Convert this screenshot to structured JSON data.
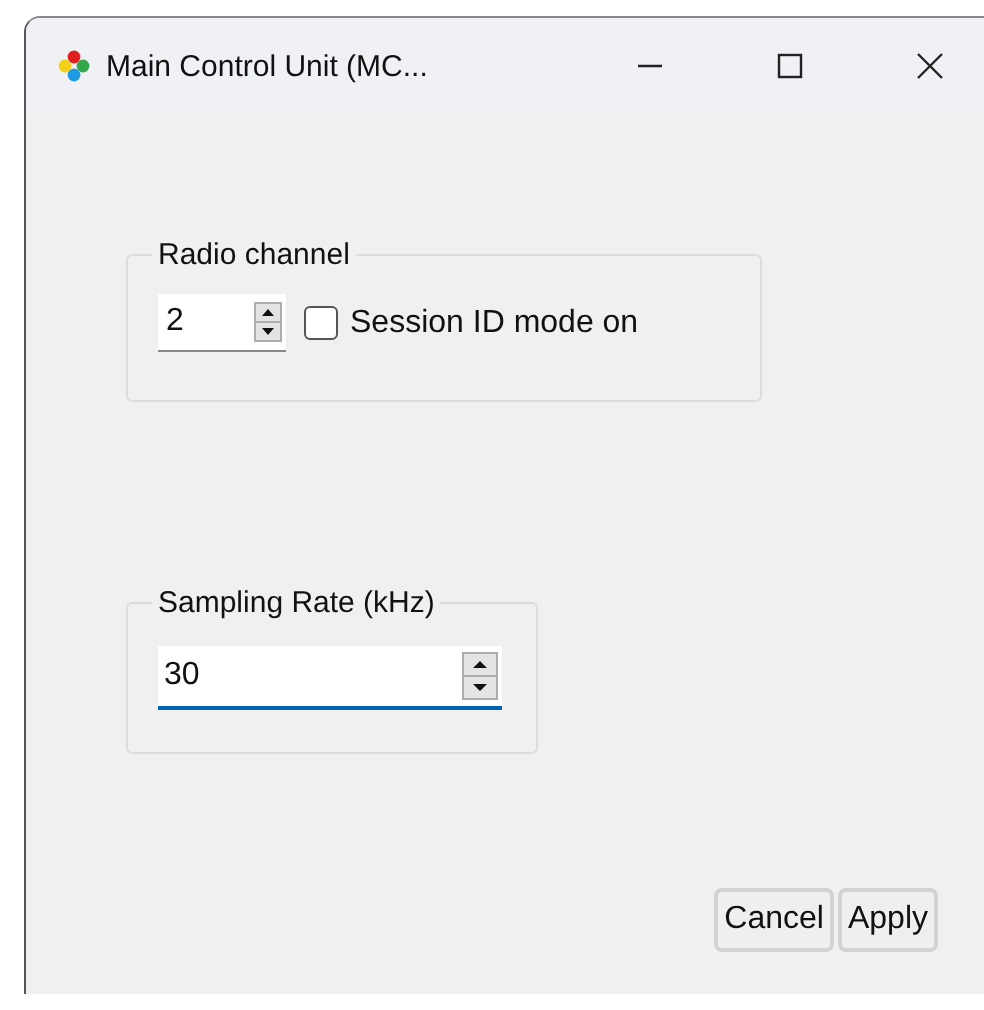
{
  "window": {
    "title": "Main Control Unit (MC..."
  },
  "radio_group": {
    "legend": "Radio channel",
    "channel": {
      "value": "2"
    },
    "session_checkbox": {
      "label": "Session ID mode on",
      "checked": false
    }
  },
  "sampling_group": {
    "legend": "Sampling Rate (kHz)",
    "rate": {
      "value": "30",
      "focused": true
    }
  },
  "buttons": [
    {
      "label": "Cancel"
    },
    {
      "label": "Apply"
    }
  ]
}
